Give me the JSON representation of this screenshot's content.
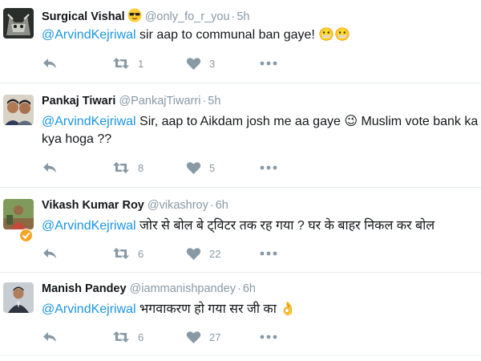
{
  "tweets": [
    {
      "name": "Surgical Vishal",
      "name_emoji": "sunglasses-emoji",
      "handle": "@only_fo_r_you",
      "time": "5h",
      "mention": "@ArvindKejriwal",
      "text": " sir aap to communal ban gaye! 😬😬",
      "retweets": "1",
      "likes": "3"
    },
    {
      "name": "Pankaj Tiwari",
      "handle": "@PankajTiwarri",
      "time": "5h",
      "mention": "@ArvindKejriwal",
      "text": " Sir, aap to Aikdam josh me aa gaye 😉 Muslim vote bank ka kya hoga ??",
      "retweets": "8",
      "likes": "5"
    },
    {
      "name": "Vikash Kumar Roy",
      "handle": "@vikashroy",
      "time": "6h",
      "mention": "@ArvindKejriwal",
      "text": " जोर से बोल बे ट्विटर तक रह गया ? घर के बाहर निकल कर बोल",
      "retweets": "6",
      "likes": "22"
    },
    {
      "name": "Manish Pandey",
      "handle": "@iammanishpandey",
      "time": "6h",
      "mention": "@ArvindKejriwal",
      "text": " भगवाकरण हो गया सर जी का 👌",
      "retweets": "6",
      "likes": "27"
    }
  ],
  "separator": "·",
  "icons": {
    "reply": "reply-icon",
    "retweet": "retweet-icon",
    "like": "heart-icon",
    "more": "more-dots-icon",
    "verified": "verified-badge-icon"
  },
  "colors": {
    "mention": "#1b95e0",
    "muted": "#8899a6",
    "divider": "#e6ecf0",
    "verified_badge": "#f5a623"
  }
}
